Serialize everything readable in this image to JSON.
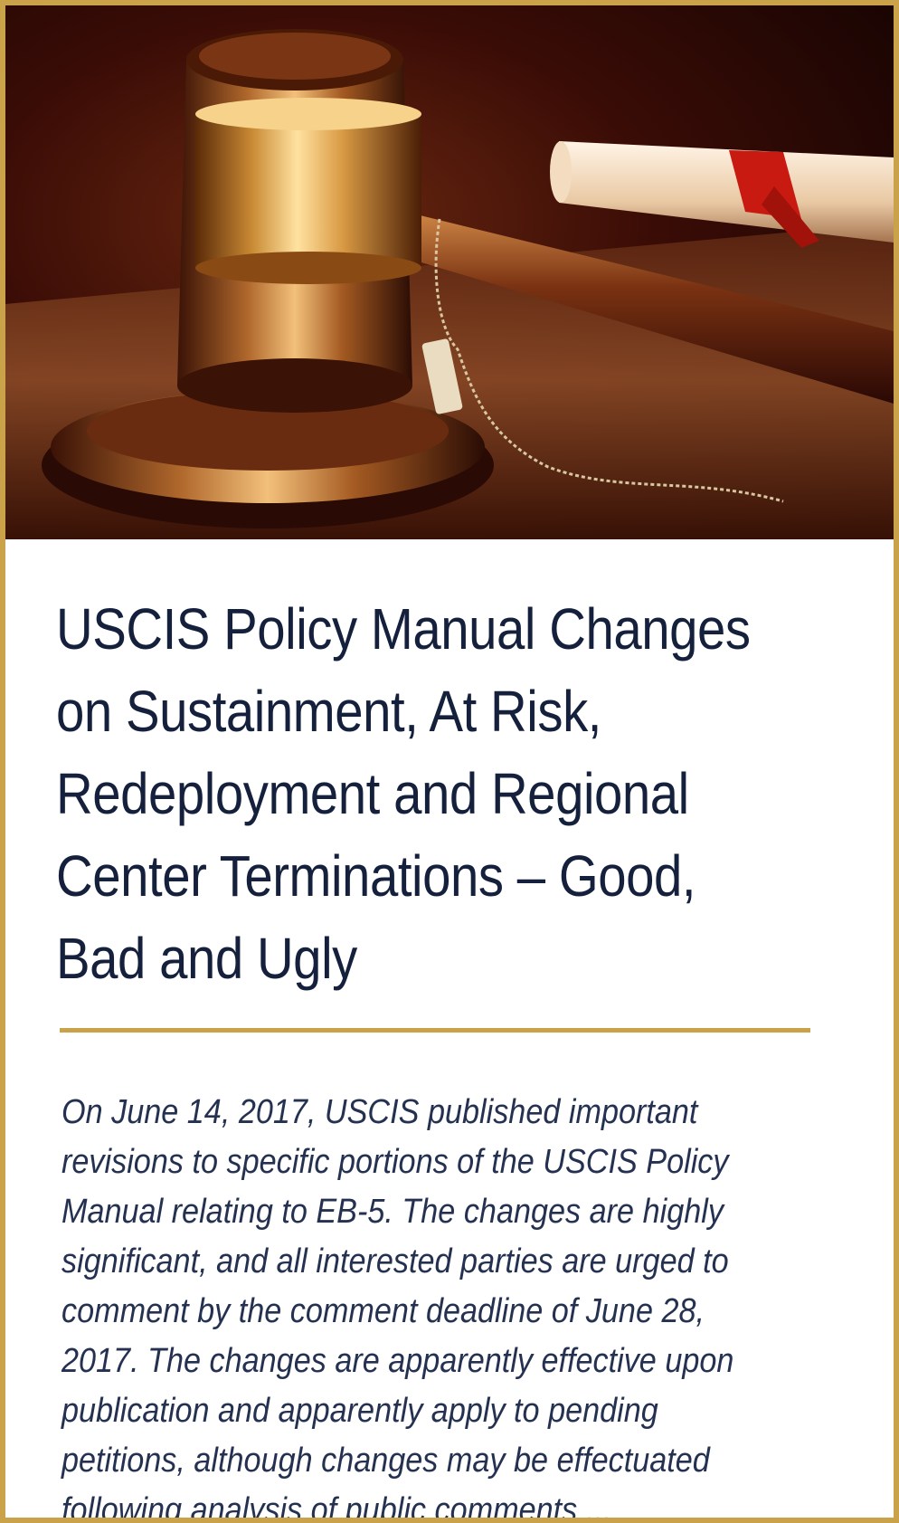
{
  "hero": {
    "image_icon": "gavel-with-scroll-photo"
  },
  "article": {
    "title": "USCIS Policy Manual Changes on Sustainment, At Risk, Redeployment and Regional Center Terminations – Good, Bad and Ugly",
    "excerpt": "On June 14, 2017, USCIS published important revisions to specific portions of the USCIS Policy Manual relating to EB-5. The changes are highly significant, and all interested parties are urged to comment by the comment deadline of June 28, 2017. The changes are apparently effective upon publication and apparently apply to pending petitions, although changes may be effectuated following analysis of public comments ..."
  },
  "colors": {
    "frame_gold": "#c9a24a",
    "title_navy": "#14203c",
    "excerpt_navy": "#243150"
  }
}
